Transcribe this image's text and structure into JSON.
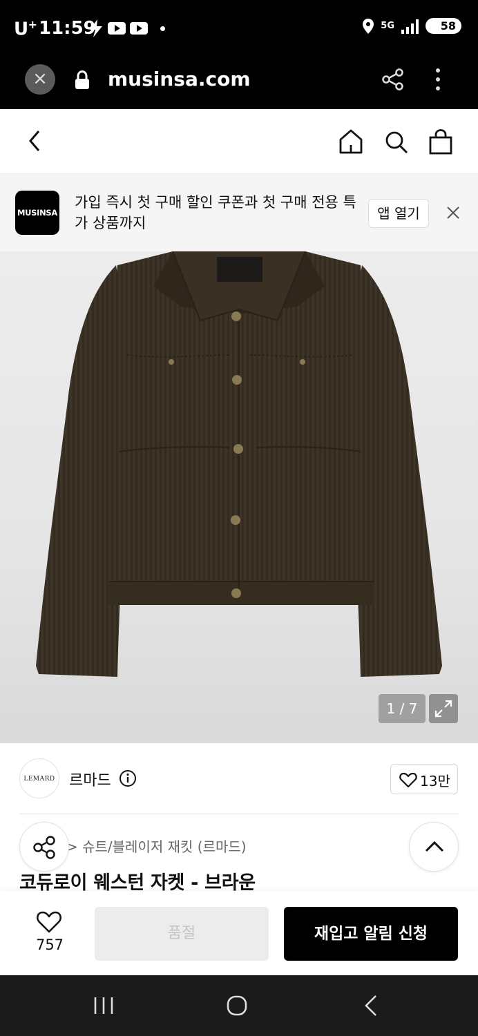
{
  "status_bar": {
    "carrier": "U",
    "carrier_sup": "+",
    "time": "11:59",
    "network": "5G",
    "battery": "58"
  },
  "browser": {
    "url": "musinsa.com"
  },
  "promo": {
    "logo_text": "MUSINSA",
    "message": "가입 즉시 첫 구매 할인 쿠폰과 첫 구매 전용 특가 상품까지",
    "open_app_label": "앱 열기"
  },
  "gallery": {
    "counter": "1 / 7"
  },
  "brand": {
    "logo_text": "LEMARD",
    "name": "르마드",
    "likes": "13만"
  },
  "product": {
    "breadcrumb": "> 슈트/블레이저 재킷 (르마드)",
    "title": "코듀로이 웨스턴 자켓 - 브라운"
  },
  "actions": {
    "wish_count": "757",
    "soldout_label": "품절",
    "restock_label": "재입고 알림 신청"
  },
  "colors": {
    "jacket": "#3b3226",
    "accent": "#000000",
    "soldout_bg": "#ececec"
  }
}
